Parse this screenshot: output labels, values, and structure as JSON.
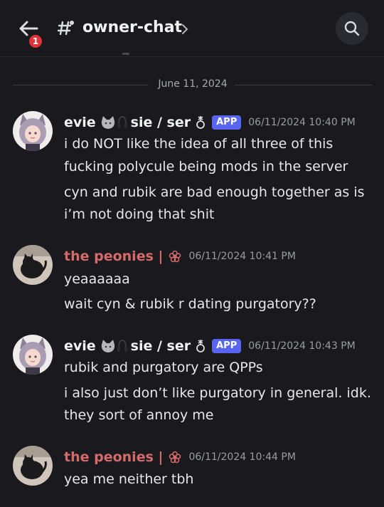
{
  "header": {
    "channel_title": "owner-chat",
    "notification_count": "1"
  },
  "date_divider": "June 11, 2024",
  "messages": [
    {
      "author": "evie",
      "pronouns": "sie / ser",
      "tag": "APP",
      "timestamp": "06/11/2024 10:40 PM",
      "lines": [
        "i do NOT like the idea of all three of this",
        "fucking polycule being mods in the server",
        "cyn and rubik are bad enough together as is",
        "i’m not doing that shit"
      ]
    },
    {
      "author": "the peonies |",
      "timestamp": "06/11/2024 10:41 PM",
      "lines": [
        "yeaaaaaa",
        "wait cyn & rubik r dating purgatory??"
      ]
    },
    {
      "author": "evie",
      "pronouns": "sie / ser",
      "tag": "APP",
      "timestamp": "06/11/2024 10:43 PM",
      "lines": [
        "rubik and purgatory are QPPs",
        "i also just don’t like purgatory in general. idk.",
        "they sort of annoy me"
      ]
    },
    {
      "author": "the peonies |",
      "timestamp": "06/11/2024 10:44 PM",
      "lines": [
        "yea me neither tbh"
      ]
    }
  ],
  "colors": {
    "background": "#1a1a1e",
    "accent_app_tag": "#5865f2",
    "peonies_name": "#d46a6a",
    "badge": "#e0343a"
  },
  "icons": [
    "back-arrow-icon",
    "channel-hash-icon",
    "chevron-right-icon",
    "search-icon",
    "cat-emoji-icon",
    "headphones-icon",
    "nonbinary-symbol-icon",
    "flower-icon"
  ]
}
